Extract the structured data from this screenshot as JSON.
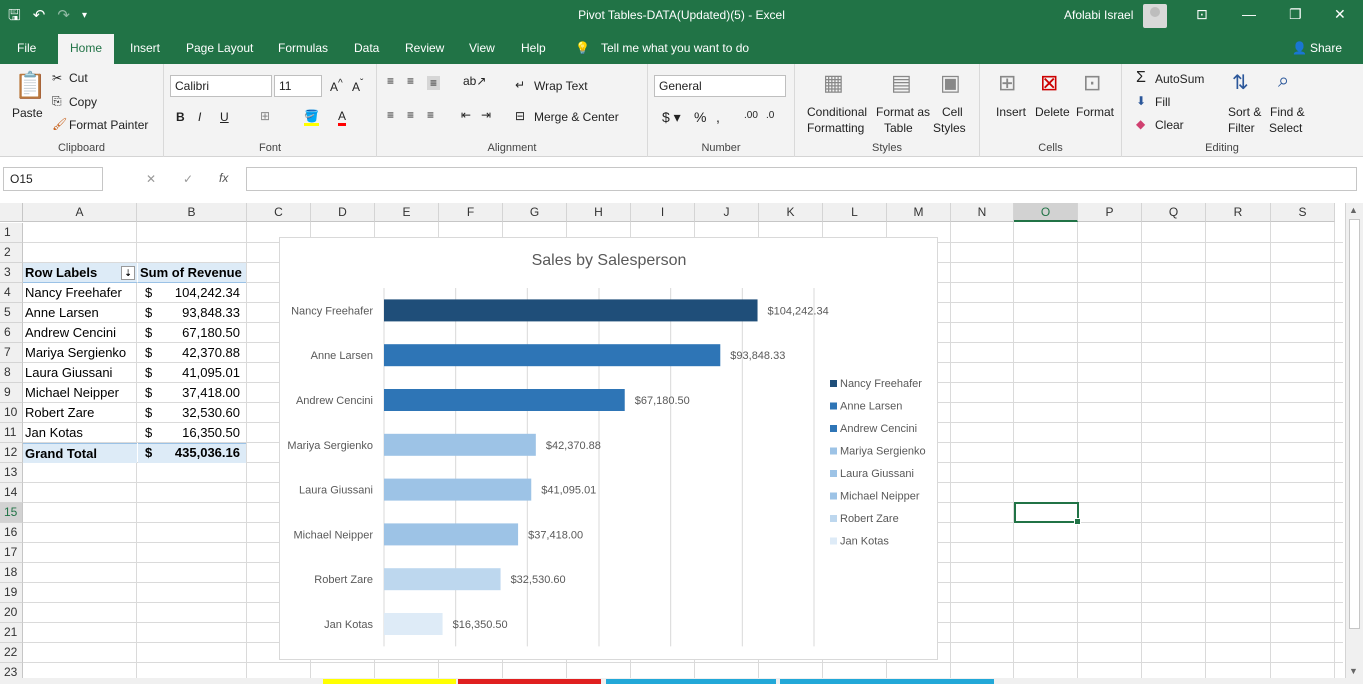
{
  "titlebar": {
    "title": "Pivot Tables-DATA(Updated)(5)  -  Excel",
    "user": "Afolabi Israel"
  },
  "tabs": [
    "File",
    "Home",
    "Insert",
    "Page Layout",
    "Formulas",
    "Data",
    "Review",
    "View",
    "Help"
  ],
  "tell_me": "Tell me what you want to do",
  "share": "Share",
  "ribbon": {
    "clipboard": {
      "label": "Clipboard",
      "paste": "Paste",
      "cut": "Cut",
      "copy": "Copy",
      "format_painter": "Format Painter"
    },
    "font": {
      "label": "Font",
      "name": "Calibri",
      "size": "11"
    },
    "alignment": {
      "label": "Alignment",
      "wrap": "Wrap Text",
      "merge": "Merge & Center"
    },
    "number": {
      "label": "Number",
      "format": "General"
    },
    "styles": {
      "label": "Styles",
      "conditional": "Conditional",
      "formatting": "Formatting",
      "format_as": "Format as",
      "table": "Table",
      "cell": "Cell",
      "cell_styles": "Styles"
    },
    "cells": {
      "label": "Cells",
      "insert": "Insert",
      "delete": "Delete",
      "format": "Format"
    },
    "editing": {
      "label": "Editing",
      "autosum": "AutoSum",
      "fill": "Fill",
      "clear": "Clear",
      "sort": "Sort &",
      "filter": "Filter",
      "find": "Find &",
      "select": "Select"
    }
  },
  "namebox": "O15",
  "columns": [
    "A",
    "B",
    "C",
    "D",
    "E",
    "F",
    "G",
    "H",
    "I",
    "J",
    "K",
    "L",
    "M",
    "N",
    "O",
    "P",
    "Q",
    "R",
    "S"
  ],
  "rows": [
    "1",
    "2",
    "3",
    "4",
    "5",
    "6",
    "7",
    "8",
    "9",
    "10",
    "11",
    "12",
    "13",
    "14",
    "15",
    "16",
    "17",
    "18",
    "19",
    "20",
    "21",
    "22",
    "23"
  ],
  "pivot": {
    "header_labels": "Row Labels",
    "header_values": "Sum of Revenue",
    "rows": [
      {
        "name": "Nancy Freehafer",
        "cur": "$",
        "value": "104,242.34"
      },
      {
        "name": "Anne Larsen",
        "cur": "$",
        "value": "93,848.33"
      },
      {
        "name": "Andrew Cencini",
        "cur": "$",
        "value": "67,180.50"
      },
      {
        "name": "Mariya Sergienko",
        "cur": "$",
        "value": "42,370.88"
      },
      {
        "name": "Laura Giussani",
        "cur": "$",
        "value": "41,095.01"
      },
      {
        "name": "Michael Neipper",
        "cur": "$",
        "value": "37,418.00"
      },
      {
        "name": "Robert Zare",
        "cur": "$",
        "value": "32,530.60"
      },
      {
        "name": "Jan Kotas",
        "cur": "$",
        "value": "16,350.50"
      }
    ],
    "total": {
      "name": "Grand Total",
      "cur": "$",
      "value": "435,036.16"
    }
  },
  "chart_data": {
    "type": "bar",
    "title": "Sales by Salesperson",
    "categories": [
      "Nancy Freehafer",
      "Anne Larsen",
      "Andrew Cencini",
      "Mariya Sergienko",
      "Laura Giussani",
      "Michael Neipper",
      "Robert Zare",
      "Jan Kotas"
    ],
    "values": [
      104242.34,
      93848.33,
      67180.5,
      42370.88,
      41095.01,
      37418.0,
      32530.6,
      16350.5
    ],
    "labels": [
      "$104,242.34",
      "$93,848.33",
      "$67,180.50",
      "$42,370.88",
      "$41,095.01",
      "$37,418.00",
      "$32,530.60",
      "$16,350.50"
    ],
    "colors": [
      "#1f4e79",
      "#2e75b6",
      "#2e75b6",
      "#9dc3e6",
      "#9dc3e6",
      "#9dc3e6",
      "#bdd7ee",
      "#deebf7"
    ],
    "xlim": [
      0,
      120000
    ],
    "grid": true,
    "legend": "right"
  }
}
